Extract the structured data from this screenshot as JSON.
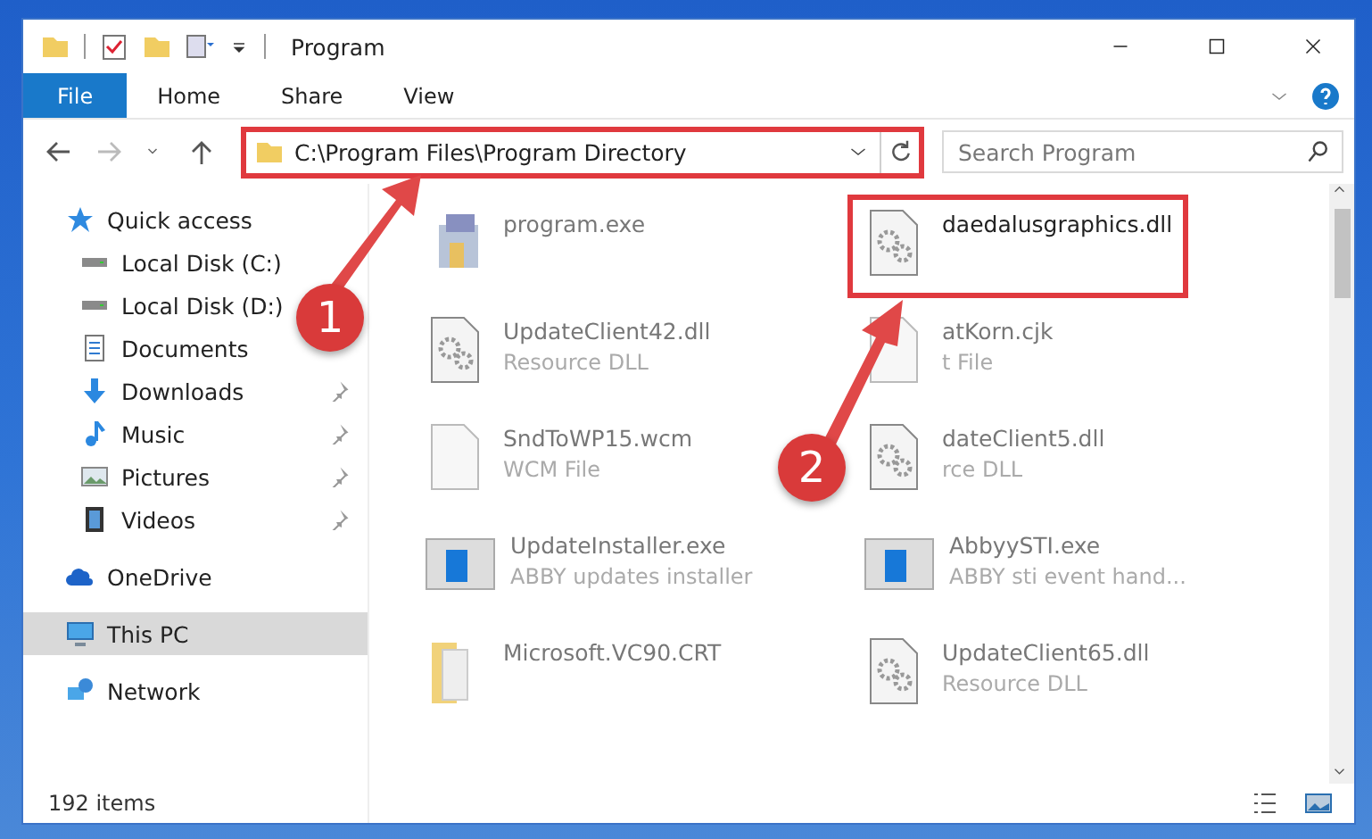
{
  "window": {
    "title": "Program"
  },
  "ribbon": {
    "tabs": [
      {
        "label": "File",
        "kind": "file"
      },
      {
        "label": "Home",
        "kind": "tab"
      },
      {
        "label": "Share",
        "kind": "tab"
      },
      {
        "label": "View",
        "kind": "tab"
      }
    ]
  },
  "address_bar": {
    "path": "C:\\Program Files\\Program Directory",
    "highlighted": true
  },
  "search": {
    "placeholder": "Search Program"
  },
  "sidebar": {
    "items": [
      {
        "label": "Quick access",
        "kind": "star",
        "selected": false,
        "children": [
          {
            "label": "Local Disk (C:)",
            "kind": "drive",
            "selected": false,
            "pinned": false
          },
          {
            "label": "Local Disk (D:)",
            "kind": "drive",
            "selected": false,
            "pinned": false
          },
          {
            "label": "Documents",
            "kind": "document",
            "selected": false,
            "pinned": false
          },
          {
            "label": "Downloads",
            "kind": "download",
            "selected": false,
            "pinned": true
          },
          {
            "label": "Music",
            "kind": "music",
            "selected": false,
            "pinned": true
          },
          {
            "label": "Pictures",
            "kind": "picture",
            "selected": false,
            "pinned": true
          },
          {
            "label": "Videos",
            "kind": "video",
            "selected": false,
            "pinned": true
          }
        ]
      },
      {
        "label": "OneDrive",
        "kind": "cloud",
        "selected": false
      },
      {
        "label": "This PC",
        "kind": "pc",
        "selected": true
      },
      {
        "label": "Network",
        "kind": "network",
        "selected": false
      }
    ]
  },
  "files": [
    {
      "name": "program.exe",
      "kind": "exe",
      "highlighted": false
    },
    {
      "name": "daedalusgraphics.dll",
      "kind": "dll",
      "highlighted": true
    },
    {
      "name": "UpdateClient42.dll",
      "description": "Resource DLL",
      "kind": "dll",
      "highlighted": false
    },
    {
      "name": "atKorn.cjk",
      "description": "t File",
      "kind": "blank",
      "highlighted": false
    },
    {
      "name": "SndToWP15.wcm",
      "description": "WCM File",
      "kind": "blank",
      "highlighted": false
    },
    {
      "name": "dateClient5.dll",
      "description": "rce DLL",
      "kind": "dll",
      "highlighted": false
    },
    {
      "name": "UpdateInstaller.exe",
      "description": "ABBY updates installer",
      "kind": "app",
      "highlighted": false
    },
    {
      "name": "AbbyySTI.exe",
      "description": "ABBY sti event hand...",
      "kind": "app",
      "highlighted": false
    },
    {
      "name": "Microsoft.VC90.CRT",
      "kind": "folder",
      "highlighted": false
    },
    {
      "name": "UpdateClient65.dll",
      "description": "Resource DLL",
      "kind": "dll",
      "highlighted": false
    }
  ],
  "status_bar": {
    "count": "192 items"
  },
  "annotations": [
    {
      "label": "1"
    },
    {
      "label": "2"
    }
  ]
}
